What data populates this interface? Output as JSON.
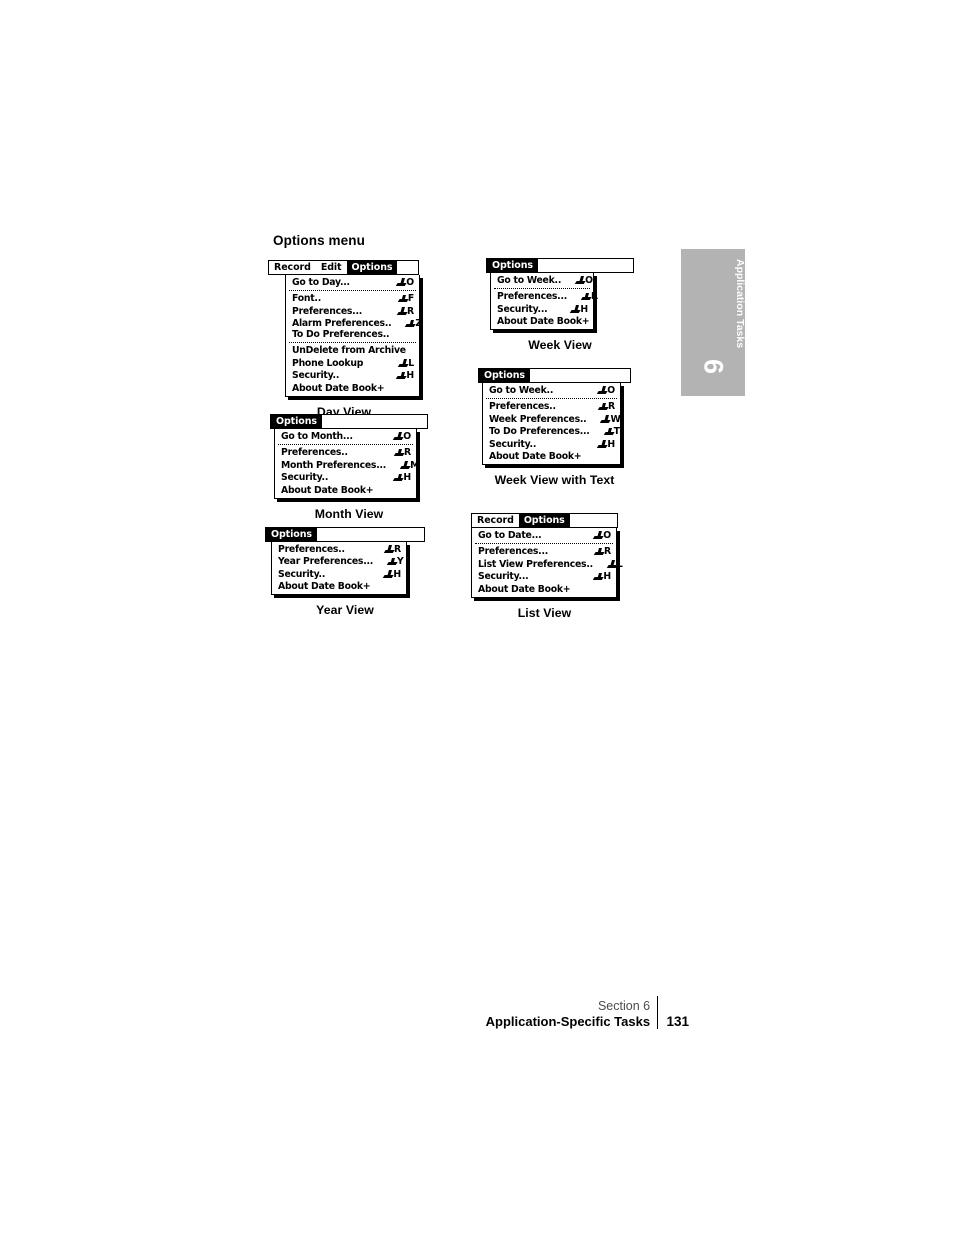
{
  "page": {
    "heading": "Options menu",
    "side_tab": {
      "label": "Application Tasks",
      "number": "6",
      "background": "#b3b3b3",
      "text_color": "#ffffff"
    },
    "footer": {
      "section": "Section 6",
      "title": "Application-Specific Tasks",
      "page_number": "131"
    }
  },
  "menus": [
    {
      "id": "day-view",
      "caption": "Day View",
      "menubar": [
        {
          "label": "Record",
          "selected": false
        },
        {
          "label": "Edit",
          "selected": false
        },
        {
          "label": "Options",
          "selected": true
        }
      ],
      "groups": [
        [
          {
            "label": "Go to Day...",
            "shortcut": "O"
          }
        ],
        [
          {
            "label": "Font..",
            "shortcut": "F"
          },
          {
            "label": "Preferences...",
            "shortcut": "R"
          },
          {
            "label": "Alarm Preferences..",
            "shortcut": "Z"
          },
          {
            "label": "To Do Preferences..",
            "shortcut": "",
            "clipped": true
          }
        ],
        [
          {
            "label": "UnDelete from Archive",
            "shortcut": ""
          },
          {
            "label": "Phone Lookup",
            "shortcut": "L"
          },
          {
            "label": "Security..",
            "shortcut": "H"
          },
          {
            "label": "About Date Book+",
            "shortcut": ""
          }
        ]
      ]
    },
    {
      "id": "week-view",
      "caption": "Week View",
      "menubar": [
        {
          "label": "Options",
          "selected": true
        }
      ],
      "groups": [
        [
          {
            "label": "Go to Week..",
            "shortcut": "O"
          }
        ],
        [
          {
            "label": "Preferences...",
            "shortcut": "R"
          },
          {
            "label": "Security...",
            "shortcut": "H"
          },
          {
            "label": "About Date Book+",
            "shortcut": ""
          }
        ]
      ]
    },
    {
      "id": "month-view",
      "caption": "Month View",
      "menubar": [
        {
          "label": "Options",
          "selected": true
        }
      ],
      "groups": [
        [
          {
            "label": "Go to Month...",
            "shortcut": "O"
          }
        ],
        [
          {
            "label": "Preferences..",
            "shortcut": "R"
          },
          {
            "label": "Month Preferences...",
            "shortcut": "M"
          },
          {
            "label": "Security..",
            "shortcut": "H"
          },
          {
            "label": "About Date Book+",
            "shortcut": ""
          }
        ]
      ]
    },
    {
      "id": "week-view-with-text",
      "caption": "Week View with Text",
      "menubar": [
        {
          "label": "Options",
          "selected": true
        }
      ],
      "groups": [
        [
          {
            "label": "Go to Week..",
            "shortcut": "O"
          }
        ],
        [
          {
            "label": "Preferences..",
            "shortcut": "R"
          },
          {
            "label": "Week Preferences..",
            "shortcut": "W"
          },
          {
            "label": "To Do Preferences...",
            "shortcut": "T"
          },
          {
            "label": "Security..",
            "shortcut": "H"
          },
          {
            "label": "About Date Book+",
            "shortcut": ""
          }
        ]
      ]
    },
    {
      "id": "year-view",
      "caption": "Year View",
      "menubar": [
        {
          "label": "Options",
          "selected": true
        }
      ],
      "groups": [
        [
          {
            "label": "Preferences..",
            "shortcut": "R"
          },
          {
            "label": "Year Preferences...",
            "shortcut": "Y"
          },
          {
            "label": "Security..",
            "shortcut": "H"
          },
          {
            "label": "About Date Book+",
            "shortcut": ""
          }
        ]
      ]
    },
    {
      "id": "list-view",
      "caption": "List View",
      "menubar": [
        {
          "label": "Record",
          "selected": false
        },
        {
          "label": "Options",
          "selected": true
        }
      ],
      "groups": [
        [
          {
            "label": "Go to Date...",
            "shortcut": "O"
          }
        ],
        [
          {
            "label": "Preferences...",
            "shortcut": "R"
          },
          {
            "label": "List View Preferences..",
            "shortcut": "L"
          },
          {
            "label": "Security...",
            "shortcut": "H"
          },
          {
            "label": "About Date Book+",
            "shortcut": ""
          }
        ]
      ]
    }
  ]
}
